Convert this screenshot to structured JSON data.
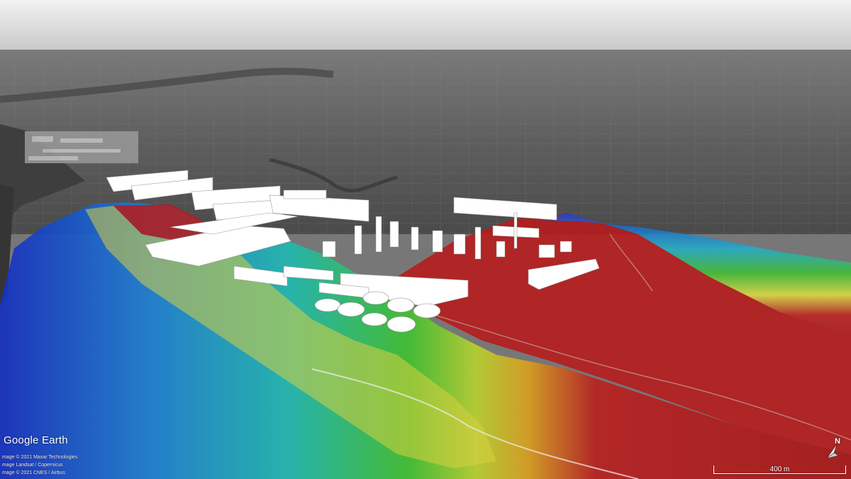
{
  "map": {
    "branding": {
      "word1": "Google",
      "word2": "Earth"
    },
    "credits": [
      "mage © 2021 Maxar Technologies",
      "mage Landsat / Copernicus",
      "mage © 2021 CNES / Airbus"
    ],
    "scale": {
      "label": "400 m"
    },
    "compass": {
      "label": "N",
      "icon": "north-arrow-icon"
    },
    "overlay_colors": [
      "#b81a1a",
      "#e0e040",
      "#38c030",
      "#20b0c8",
      "#1a40d0"
    ],
    "sky_color": "#d8d8d8"
  }
}
